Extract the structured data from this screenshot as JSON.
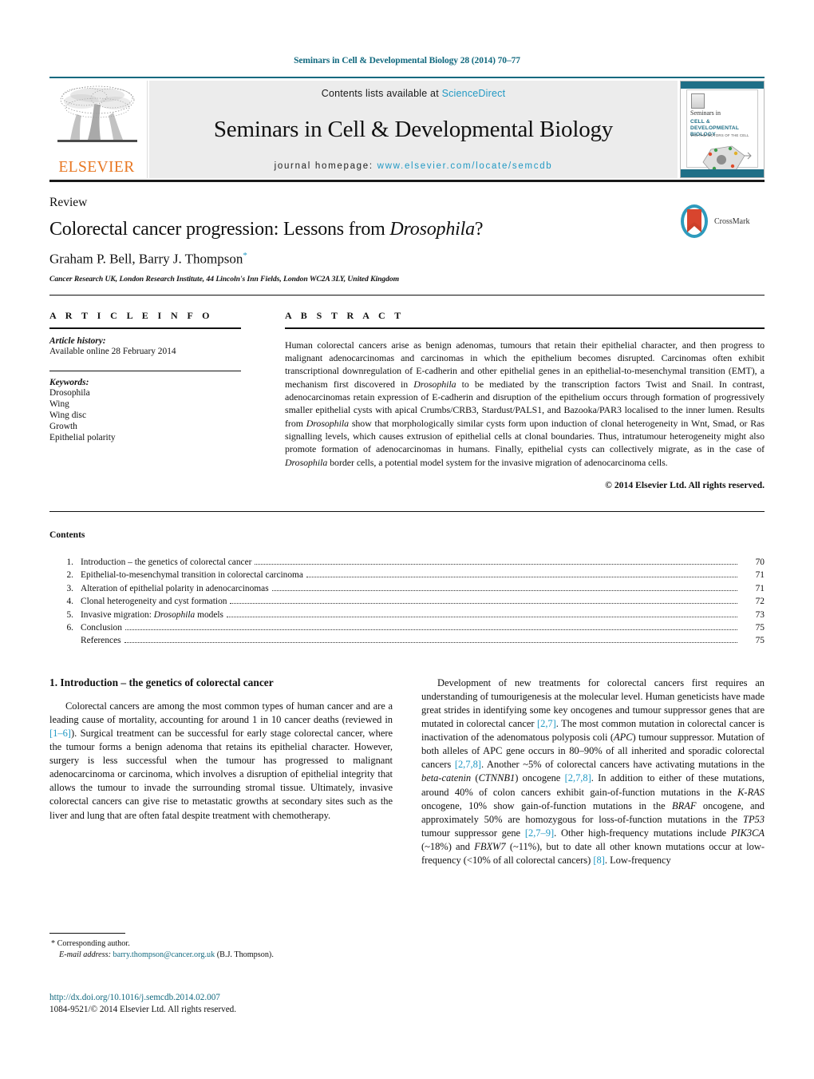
{
  "running_head": "Seminars in Cell & Developmental Biology 28 (2014) 70–77",
  "masthead": {
    "publisher_name": "ELSEVIER",
    "contents_prefix": "Contents lists available at",
    "contents_link": "ScienceDirect",
    "journal_title": "Seminars in Cell & Developmental Biology",
    "homepage_prefix": "journal homepage:",
    "homepage_url": "www.elsevier.com/locate/semcdb",
    "cover": {
      "line1": "Seminars in",
      "line2": "CELL & DEVELOPMENTAL BIOLOGY",
      "line3": "VAN THE MOTORS OF THE CELL"
    }
  },
  "article": {
    "kicker": "Review",
    "title_plain": "Colorectal cancer progression: Lessons from Drosophila?",
    "title_pre": "Colorectal cancer progression: Lessons from ",
    "title_italic": "Drosophila",
    "title_post": "?",
    "authors": "Graham P. Bell, Barry J. Thompson",
    "author_marker": "*",
    "affiliation": "Cancer Research UK, London Research Institute, 44 Lincoln's Inn Fields, London WC2A 3LY, United Kingdom",
    "crossmark_label": "CrossMark"
  },
  "article_info": {
    "heading": "A R T I C L E    I N F O",
    "history_label": "Article history:",
    "history_value": "Available online 28 February 2014",
    "keywords_label": "Keywords:",
    "keywords": [
      "Drosophila",
      "Wing",
      "Wing disc",
      "Growth",
      "Epithelial polarity"
    ]
  },
  "abstract": {
    "heading": "A B S T R A C T",
    "p1_a": "Human colorectal cancers arise as benign adenomas, tumours that retain their epithelial character, and then progress to malignant adenocarcinomas and carcinomas in which the epithelium becomes disrupted. Carcinomas often exhibit transcriptional downregulation of E-cadherin and other epithelial genes in an epithelial-to-mesenchymal transition (EMT), a mechanism first discovered in ",
    "p1_i1": "Drosophila",
    "p1_b": " to be mediated by the transcription factors Twist and Snail. In contrast, adenocarcinomas retain expression of E-cadherin and disruption of the epithelium occurs through formation of progressively smaller epithelial cysts with apical Crumbs/CRB3, Stardust/PALS1, and Bazooka/PAR3 localised to the inner lumen. Results from ",
    "p1_i2": "Drosophila",
    "p1_c": " show that morphologically similar cysts form upon induction of clonal heterogeneity in Wnt, Smad, or Ras signalling levels, which causes extrusion of epithelial cells at clonal boundaries. Thus, intratumour heterogeneity might also promote formation of adenocarcinomas in humans. Finally, epithelial cysts can collectively migrate, as in the case of ",
    "p1_i3": "Drosophila",
    "p1_d": " border cells, a potential model system for the invasive migration of adenocarcinoma cells.",
    "copyright": "© 2014 Elsevier Ltd. All rights reserved."
  },
  "contents": {
    "title": "Contents",
    "items": [
      {
        "num": "1.",
        "label": "Introduction – the genetics of colorectal cancer",
        "page": "70"
      },
      {
        "num": "2.",
        "label": "Epithelial-to-mesenchymal transition in colorectal carcinoma",
        "page": "71"
      },
      {
        "num": "3.",
        "label": "Alteration of epithelial polarity in adenocarcinomas",
        "page": "71"
      },
      {
        "num": "4.",
        "label": "Clonal heterogeneity and cyst formation",
        "page": "72"
      },
      {
        "num": "5.",
        "label": "Invasive migration: Drosophila models",
        "page": "73"
      },
      {
        "num": "6.",
        "label": "Conclusion",
        "page": "75"
      },
      {
        "num": "",
        "label": "References",
        "page": "75"
      }
    ]
  },
  "body": {
    "section1_heading": "1.  Introduction – the genetics of colorectal cancer",
    "left_p1_a": "Colorectal cancers are among the most common types of human cancer and are a leading cause of mortality, accounting for around 1 in 10 cancer deaths (reviewed in ",
    "left_p1_ref1": "[1–6]",
    "left_p1_b": "). Surgical treatment can be successful for early stage colorectal cancer, where the tumour forms a benign adenoma that retains its epithelial character. However, surgery is less successful when the tumour has progressed to malignant adenocarcinoma or carcinoma, which involves a disruption of epithelial integrity that allows the tumour to invade the surrounding stromal tissue. Ultimately, invasive colorectal cancers can give rise to metastatic growths at secondary sites such as the liver and lung that are often fatal despite treatment with chemotherapy.",
    "right_p1_a": "Development of new treatments for colorectal cancers first requires an understanding of tumourigenesis at the molecular level. Human geneticists have made great strides in identifying some key oncogenes and tumour suppressor genes that are mutated in colorectal cancer ",
    "right_p1_ref1": "[2,7]",
    "right_p1_b": ". The most common mutation in colorectal cancer is inactivation of the adenomatous polyposis coli (",
    "right_p1_i1": "APC",
    "right_p1_c": ") tumour suppressor. Mutation of both alleles of APC gene occurs in 80–90% of all inherited and sporadic colorectal cancers ",
    "right_p1_ref2": "[2,7,8]",
    "right_p1_d": ". Another ~5% of colorectal cancers have activating mutations in the ",
    "right_p1_i2": "beta-catenin",
    "right_p1_e": " (",
    "right_p1_i3": "CTNNB1",
    "right_p1_f": ") oncogene ",
    "right_p1_ref3": "[2,7,8]",
    "right_p1_g": ". In addition to either of these mutations, around 40% of colon cancers exhibit gain-of-function mutations in the ",
    "right_p1_i4": "K-RAS",
    "right_p1_h": " oncogene, 10% show gain-of-function mutations in the ",
    "right_p1_i5": "BRAF",
    "right_p1_j": " oncogene, and approximately 50% are homozygous for loss-of-function mutations in the ",
    "right_p1_i6": "TP53",
    "right_p1_k": " tumour suppressor gene ",
    "right_p1_ref4": "[2,7–9]",
    "right_p1_l": ". Other high-frequency mutations include ",
    "right_p1_i7": "PIK3CA",
    "right_p1_m": " (~18%) and ",
    "right_p1_i8": "FBXW7",
    "right_p1_n": " (~11%), but to date all other known mutations occur at low-frequency (<10% of all colorectal cancers) ",
    "right_p1_ref5": "[8]",
    "right_p1_o": ". Low-frequency"
  },
  "footnotes": {
    "star": "*",
    "corresponding": "Corresponding author.",
    "email_label": "E-mail address:",
    "email": "barry.thompson@cancer.org.uk",
    "email_suffix": "(B.J. Thompson).",
    "doi": "http://dx.doi.org/10.1016/j.semcdb.2014.02.007",
    "issn": "1084-9521/© 2014 Elsevier Ltd. All rights reserved."
  },
  "colors": {
    "link": "#2199c4",
    "rule_teal": "#12697f",
    "elsevier_orange": "#E87722",
    "cover_band": "#1f6f87"
  }
}
